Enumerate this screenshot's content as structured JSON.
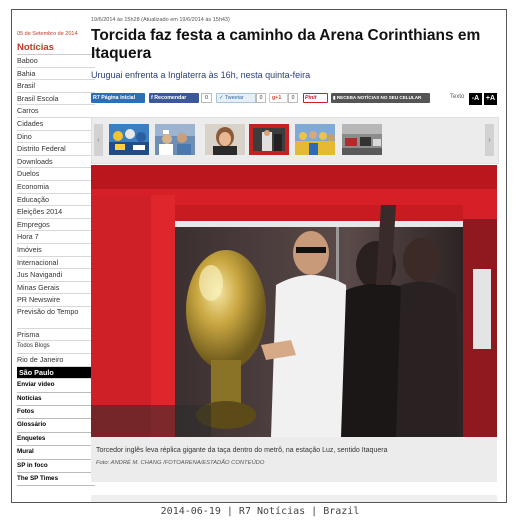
{
  "sidebar": {
    "date": "05 de Setembro de 2014",
    "heading": "Notícias",
    "items": [
      "Baboo",
      "Bahia",
      "Brasil",
      "Brasil Escola",
      "Carros",
      "Cidades",
      "Dino",
      "Distrito Federal",
      "Downloads",
      "Duelos",
      "Economia",
      "Educação",
      "Eleições 2014",
      "Empregos",
      "Hora 7",
      "Imóveis",
      "Internacional",
      "Jus Navigandi",
      "Minas Gerais",
      "PR Newswire",
      "Previsão do Tempo",
      "Prisma",
      "Todos Blogs",
      "Rio de Janeiro",
      "São Paulo"
    ],
    "active_item": "São Paulo",
    "bold_items": [
      "Enviar vídeo",
      "Notícias",
      "Fotos",
      "Glossário",
      "Enquetes",
      "Mural",
      "SP in foco",
      "The SP Times"
    ]
  },
  "article": {
    "timestamp": "19/6/2014 às 15h28 (Atualizado em 19/6/2014 às 15h43)",
    "headline": "Torcida faz festa a caminho da Arena Corinthians em Itaquera",
    "subtitle": "Uruguai enfrenta a Inglaterra às 16h, nesta quinta-feira",
    "caption": "Torcedor inglês leva réplica gigante da taça dentro do metrô, na estação Luz, sentido Itaquera",
    "credit": "Foto: ANDRÉ M. CHANG /FOTOARENA/ESTADÃO CONTEÚDO"
  },
  "share": {
    "r7_label": "R7 Página inicial",
    "facebook_label": "f Recomendar",
    "facebook_count": "0",
    "twitter_label": "✓ Tweetar",
    "twitter_count": "0",
    "gplus_label": "g+1",
    "gplus_count": "0",
    "pinit_label": "Pinit",
    "mobile_label": "RECEBA NOTÍCIAS NO SEU CELULAR",
    "text_size_label": "Texto",
    "text_minus": "-A",
    "text_plus": "+A"
  },
  "carousel": {
    "prev_icon": "chevron-left-icon",
    "next_icon": "chevron-right-icon"
  },
  "footer": "2014-06-19 | R7 Notícias | Brazil",
  "colors": {
    "accent": "#c0392b",
    "link": "#2c3e80",
    "subway_red": "#d61f26"
  }
}
